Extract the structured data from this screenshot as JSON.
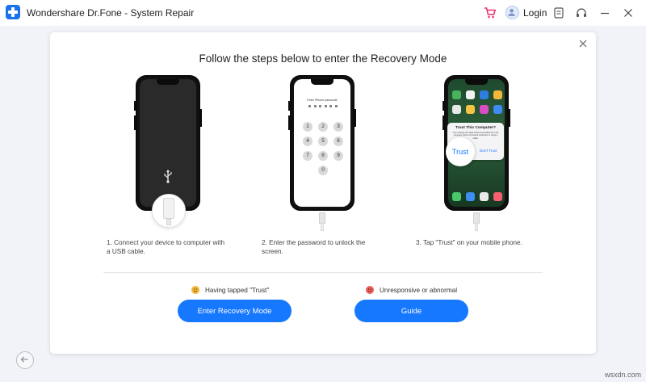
{
  "titlebar": {
    "app_title": "Wondershare Dr.Fone - System Repair",
    "login_label": "Login"
  },
  "main": {
    "heading": "Follow the steps below to enter the Recovery Mode",
    "steps": [
      {
        "text": "1. Connect your device to computer with a USB cable."
      },
      {
        "text": "2. Enter the password to unlock the screen."
      },
      {
        "text": "3. Tap \"Trust\" on your mobile phone."
      }
    ],
    "phone2": {
      "passcode_prompt": "Enter iPhone passcode",
      "keys": [
        "1",
        "2",
        "3",
        "4",
        "5",
        "6",
        "7",
        "8",
        "9",
        "0"
      ]
    },
    "phone3": {
      "dialog_title": "Trust This Computer?",
      "dialog_body": "Your settings and data will be accessible from this computer when connected wirelessly or using a cable.",
      "trust_label": "Trust",
      "dont_trust_label": "Don't Trust"
    },
    "options": [
      {
        "label": "Having tapped \"Trust\"",
        "button": "Enter Recovery Mode"
      },
      {
        "label": "Unresponsive or abnormal",
        "button": "Guide"
      }
    ]
  },
  "watermark": "wsxdn.com",
  "colors": {
    "accent": "#1677ff",
    "logo": "#1a73e8",
    "cart": "#e8336f"
  }
}
